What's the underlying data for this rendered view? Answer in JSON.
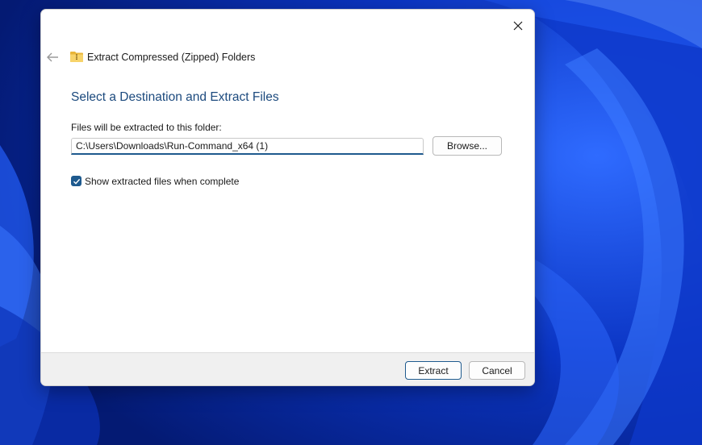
{
  "window": {
    "title": "Extract Compressed (Zipped) Folders"
  },
  "main": {
    "heading": "Select a Destination and Extract Files",
    "destination_label": "Files will be extracted to this folder:",
    "destination_path": "C:\\Users\\Downloads\\Run-Command_x64 (1)",
    "browse_label": "Browse...",
    "show_files_label": "Show extracted files when complete",
    "show_files_checked": true
  },
  "footer": {
    "extract_label": "Extract",
    "cancel_label": "Cancel"
  },
  "colors": {
    "accent": "#1e5a8e",
    "heading": "#1c4a7e",
    "footer_bg": "#f0f0f0"
  },
  "icons": {
    "close": "close-icon",
    "back": "back-arrow-icon",
    "folder": "zip-folder-icon",
    "check": "checkmark-icon"
  }
}
